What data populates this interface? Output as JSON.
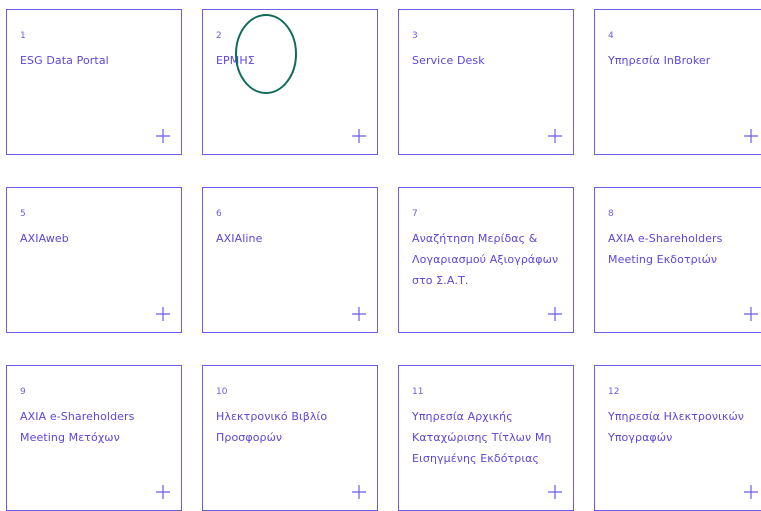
{
  "services": [
    {
      "number": "1",
      "label": "ESG Data Portal"
    },
    {
      "number": "2",
      "label": "ΕΡΜΗΣ"
    },
    {
      "number": "3",
      "label": "Service Desk"
    },
    {
      "number": "4",
      "label": "Υπηρεσία InBroker"
    },
    {
      "number": "5",
      "label": "AXIAweb"
    },
    {
      "number": "6",
      "label": "AXIAline"
    },
    {
      "number": "7",
      "label": "Αναζήτηση Μερίδας & Λογαριασμού Αξιογράφων στο Σ.Α.Τ."
    },
    {
      "number": "8",
      "label": "AXIA e-Shareholders Meeting Εκδοτριών"
    },
    {
      "number": "9",
      "label": "AXIA e-Shareholders Meeting Μετόχων"
    },
    {
      "number": "10",
      "label": "Ηλεκτρονικό Βιβλίο Προσφορών"
    },
    {
      "number": "11",
      "label": "Υπηρεσία Αρχικής Καταχώρισης Τίτλων Μη Εισηγμένης Εκδότριας"
    },
    {
      "number": "12",
      "label": "Υπηρεσία Ηλεκτρονικών Υπογραφών"
    }
  ],
  "icons": {
    "expand": "plus-icon",
    "highlight": "circle-annotation"
  },
  "colors": {
    "accent": "#6a5ee9",
    "label": "#5b46df",
    "annotation": "#0f6b5a"
  }
}
